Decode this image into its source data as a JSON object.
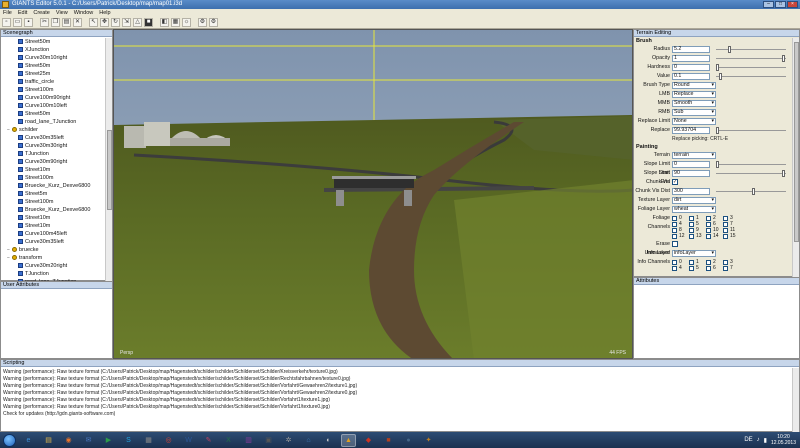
{
  "window": {
    "title": "GIANTS Editor 5.0.1 - C:/Users/Patrick/Desktop/map/map01.i3d"
  },
  "menu": [
    "File",
    "Edit",
    "Create",
    "View",
    "Window",
    "Help"
  ],
  "panels": {
    "scenegraph": "Scenegraph",
    "user_attributes": "User Attributes",
    "terrain_editing": "Terrain Editing",
    "attributes": "Attributes",
    "scripting": "Scripting"
  },
  "scenegraph": {
    "items": [
      {
        "label": "Street50m",
        "group": false,
        "indent": 2
      },
      {
        "label": "XJunction",
        "group": false,
        "indent": 2
      },
      {
        "label": "Curve30m10right",
        "group": false,
        "indent": 2
      },
      {
        "label": "Street50m",
        "group": false,
        "indent": 2
      },
      {
        "label": "Street25m",
        "group": false,
        "indent": 2
      },
      {
        "label": "traffic_circle",
        "group": false,
        "indent": 2
      },
      {
        "label": "Street100m",
        "group": false,
        "indent": 2
      },
      {
        "label": "Curve100m90right",
        "group": false,
        "indent": 2
      },
      {
        "label": "Curve100m10left",
        "group": false,
        "indent": 2
      },
      {
        "label": "Street50m",
        "group": false,
        "indent": 2
      },
      {
        "label": "road_lane_TJunction",
        "group": false,
        "indent": 2
      },
      {
        "label": "schilder",
        "group": true,
        "indent": 1
      },
      {
        "label": "Curve30m35left",
        "group": false,
        "indent": 2
      },
      {
        "label": "Curve30m30right",
        "group": false,
        "indent": 2
      },
      {
        "label": "TJunction",
        "group": false,
        "indent": 2
      },
      {
        "label": "Curve30m90right",
        "group": false,
        "indent": 2
      },
      {
        "label": "Street10m",
        "group": false,
        "indent": 2
      },
      {
        "label": "Street100m",
        "group": false,
        "indent": 2
      },
      {
        "label": "Bruecke_Kurz_Dexve6800",
        "group": false,
        "indent": 2
      },
      {
        "label": "Street5m",
        "group": false,
        "indent": 2
      },
      {
        "label": "Street100m",
        "group": false,
        "indent": 2
      },
      {
        "label": "Bruecke_Kurz_Dexve6800",
        "group": false,
        "indent": 2
      },
      {
        "label": "Street10m",
        "group": false,
        "indent": 2
      },
      {
        "label": "Street10m",
        "group": false,
        "indent": 2
      },
      {
        "label": "Curve100m45left",
        "group": false,
        "indent": 2
      },
      {
        "label": "Curve30m35left",
        "group": false,
        "indent": 2
      },
      {
        "label": "bruecke",
        "group": true,
        "indent": 1
      },
      {
        "label": "transform",
        "group": true,
        "indent": 1
      },
      {
        "label": "Curve30m20right",
        "group": false,
        "indent": 2
      },
      {
        "label": "TJunction",
        "group": false,
        "indent": 2
      },
      {
        "label": "road_lane_TJunction",
        "group": false,
        "indent": 2
      },
      {
        "label": "road_lane_TJunction",
        "group": false,
        "indent": 2
      },
      {
        "label": "Street50m",
        "group": false,
        "indent": 2
      }
    ]
  },
  "viewport": {
    "left_label": "Persp",
    "right_label": "44 FPS"
  },
  "terrain": {
    "brush_title": "Brush",
    "radius": {
      "label": "Radius",
      "value": "5.2",
      "level": 0.18
    },
    "opacity": {
      "label": "Opacity",
      "value": "1",
      "level": 1.0
    },
    "hardness": {
      "label": "Hardness",
      "value": "0",
      "level": 0.0
    },
    "value": {
      "label": "Value",
      "value": "0.1",
      "level": 0.05
    },
    "brush_type": {
      "label": "Brush Type",
      "value": "Round"
    },
    "lmb": {
      "label": "LMB",
      "value": "Replace"
    },
    "mmb": {
      "label": "MMB",
      "value": "Smooth"
    },
    "rmb": {
      "label": "RMB",
      "value": "Sub"
    },
    "replace_limit": {
      "label": "Replace Limit",
      "value": "None"
    },
    "replace": {
      "label": "Replace",
      "value": "99.93704",
      "level": 0.0
    },
    "replace_hint": "Replace picking: CRTL-E",
    "painting_title": "Painting",
    "terrain": {
      "label": "Terrain",
      "value": "terrain"
    },
    "slope_start": {
      "label": "Slope Limit Start",
      "value": "0",
      "level": 0.0
    },
    "slope_end": {
      "label": "Slope Limit End",
      "value": "90",
      "level": 1.0
    },
    "chunk_vis": {
      "label": "Chunk Vis",
      "checked": "✓"
    },
    "chunk_vis_dist": {
      "label": "Chunk Vis Dist",
      "value": "300",
      "level": 0.55
    },
    "texture_layer": {
      "label": "Texture Layer",
      "value": "dirt"
    },
    "foliage_layer": {
      "label": "Foliage Layer",
      "value": "wheat"
    },
    "foliage_channels": {
      "label": "Foliage Channels",
      "values": [
        "0",
        "1",
        "2",
        "3",
        "4",
        "5",
        "6",
        "7",
        "8",
        "9",
        "10",
        "11",
        "12",
        "13",
        "14",
        "15"
      ]
    },
    "erase_unmasked": {
      "label": "Erase Unmasked",
      "checked": ""
    },
    "info_layer": {
      "label": "Info Layer",
      "value": "infoLayer"
    },
    "info_channels": {
      "label": "Info Channels",
      "values": [
        "0",
        "1",
        "2",
        "3",
        "4",
        "5",
        "6",
        "7"
      ]
    }
  },
  "scripting": {
    "lines": [
      "Warning (performance): Raw texture format (C:/Users/Patrick/Desktop/map/Hagenstedt/schilder/schilder/Schilderset/Schilder/Kreisverkehr/texture0.jpg)",
      "Warning (performance): Raw texture format (C:/Users/Patrick/Desktop/map/Hagenstedt/schilder/schilder/Schilderset/Schilder/Rechtsfahrbahnen/texture0.jpg)",
      "Warning (performance): Raw texture format (C:/Users/Patrick/Desktop/map/Hagenstedt/schilder/schilder/Schilderset/Schilder/Vorfahrt/Gewaehren2/texture1.jpg)",
      "Warning (performance): Raw texture format (C:/Users/Patrick/Desktop/map/Hagenstedt/schilder/schilder/Schilderset/Schilder/Vorfahrt/Gewaehren2/texture0.jpg)",
      "Warning (performance): Raw texture format (C:/Users/Patrick/Desktop/map/Hagenstedt/schilder/schilder/Schilderset/Schilder/Vorfahrt1/texture1.jpg)",
      "Warning (performance): Raw texture format (C:/Users/Patrick/Desktop/map/Hagenstedt/schilder/schilder/Schilderset/Schilder/Vorfahrt1/texture0.jpg)",
      "Check for updates (http://gdn.giants-software.com)"
    ]
  },
  "taskbar": {
    "apps": [
      {
        "name": "ie-icon",
        "glyph": "e",
        "color": "#3b8fd8"
      },
      {
        "name": "folder-icon",
        "glyph": "▤",
        "color": "#e0b64a"
      },
      {
        "name": "firefox-icon",
        "glyph": "◉",
        "color": "#e8732a"
      },
      {
        "name": "thunderbird-icon",
        "glyph": "✉",
        "color": "#4a78c0"
      },
      {
        "name": "media-icon",
        "glyph": "▶",
        "color": "#2d9c4a"
      },
      {
        "name": "skype-icon",
        "glyph": "S",
        "color": "#1fa3e0"
      },
      {
        "name": "calculator-icon",
        "glyph": "▦",
        "color": "#888888"
      },
      {
        "name": "chrome-icon",
        "glyph": "◎",
        "color": "#dd4433"
      },
      {
        "name": "word-icon",
        "glyph": "W",
        "color": "#2b5797"
      },
      {
        "name": "paint-icon",
        "glyph": "✎",
        "color": "#c04060"
      },
      {
        "name": "excel-icon",
        "glyph": "X",
        "color": "#1e7145"
      },
      {
        "name": "winrar-icon",
        "glyph": "▥",
        "color": "#8a3c9c"
      },
      {
        "name": "video-icon",
        "glyph": "▣",
        "color": "#555555"
      },
      {
        "name": "settings-icon",
        "glyph": "✲",
        "color": "#999999"
      },
      {
        "name": "network-icon",
        "glyph": "⌂",
        "color": "#3a7ab8"
      },
      {
        "name": "player-icon",
        "glyph": "◐",
        "color": "#cccccc"
      },
      {
        "name": "giants-icon",
        "glyph": "▲",
        "color": "#e0a020"
      },
      {
        "name": "tractor-icon",
        "glyph": "◆",
        "color": "#cc3322"
      },
      {
        "name": "cube-icon",
        "glyph": "■",
        "color": "#b04020"
      },
      {
        "name": "game-icon",
        "glyph": "●",
        "color": "#446688"
      },
      {
        "name": "app-icon",
        "glyph": "✦",
        "color": "#c08020"
      }
    ],
    "active_index": 16,
    "lang": "DE",
    "time": "10:20",
    "date": "12.05.2013"
  }
}
